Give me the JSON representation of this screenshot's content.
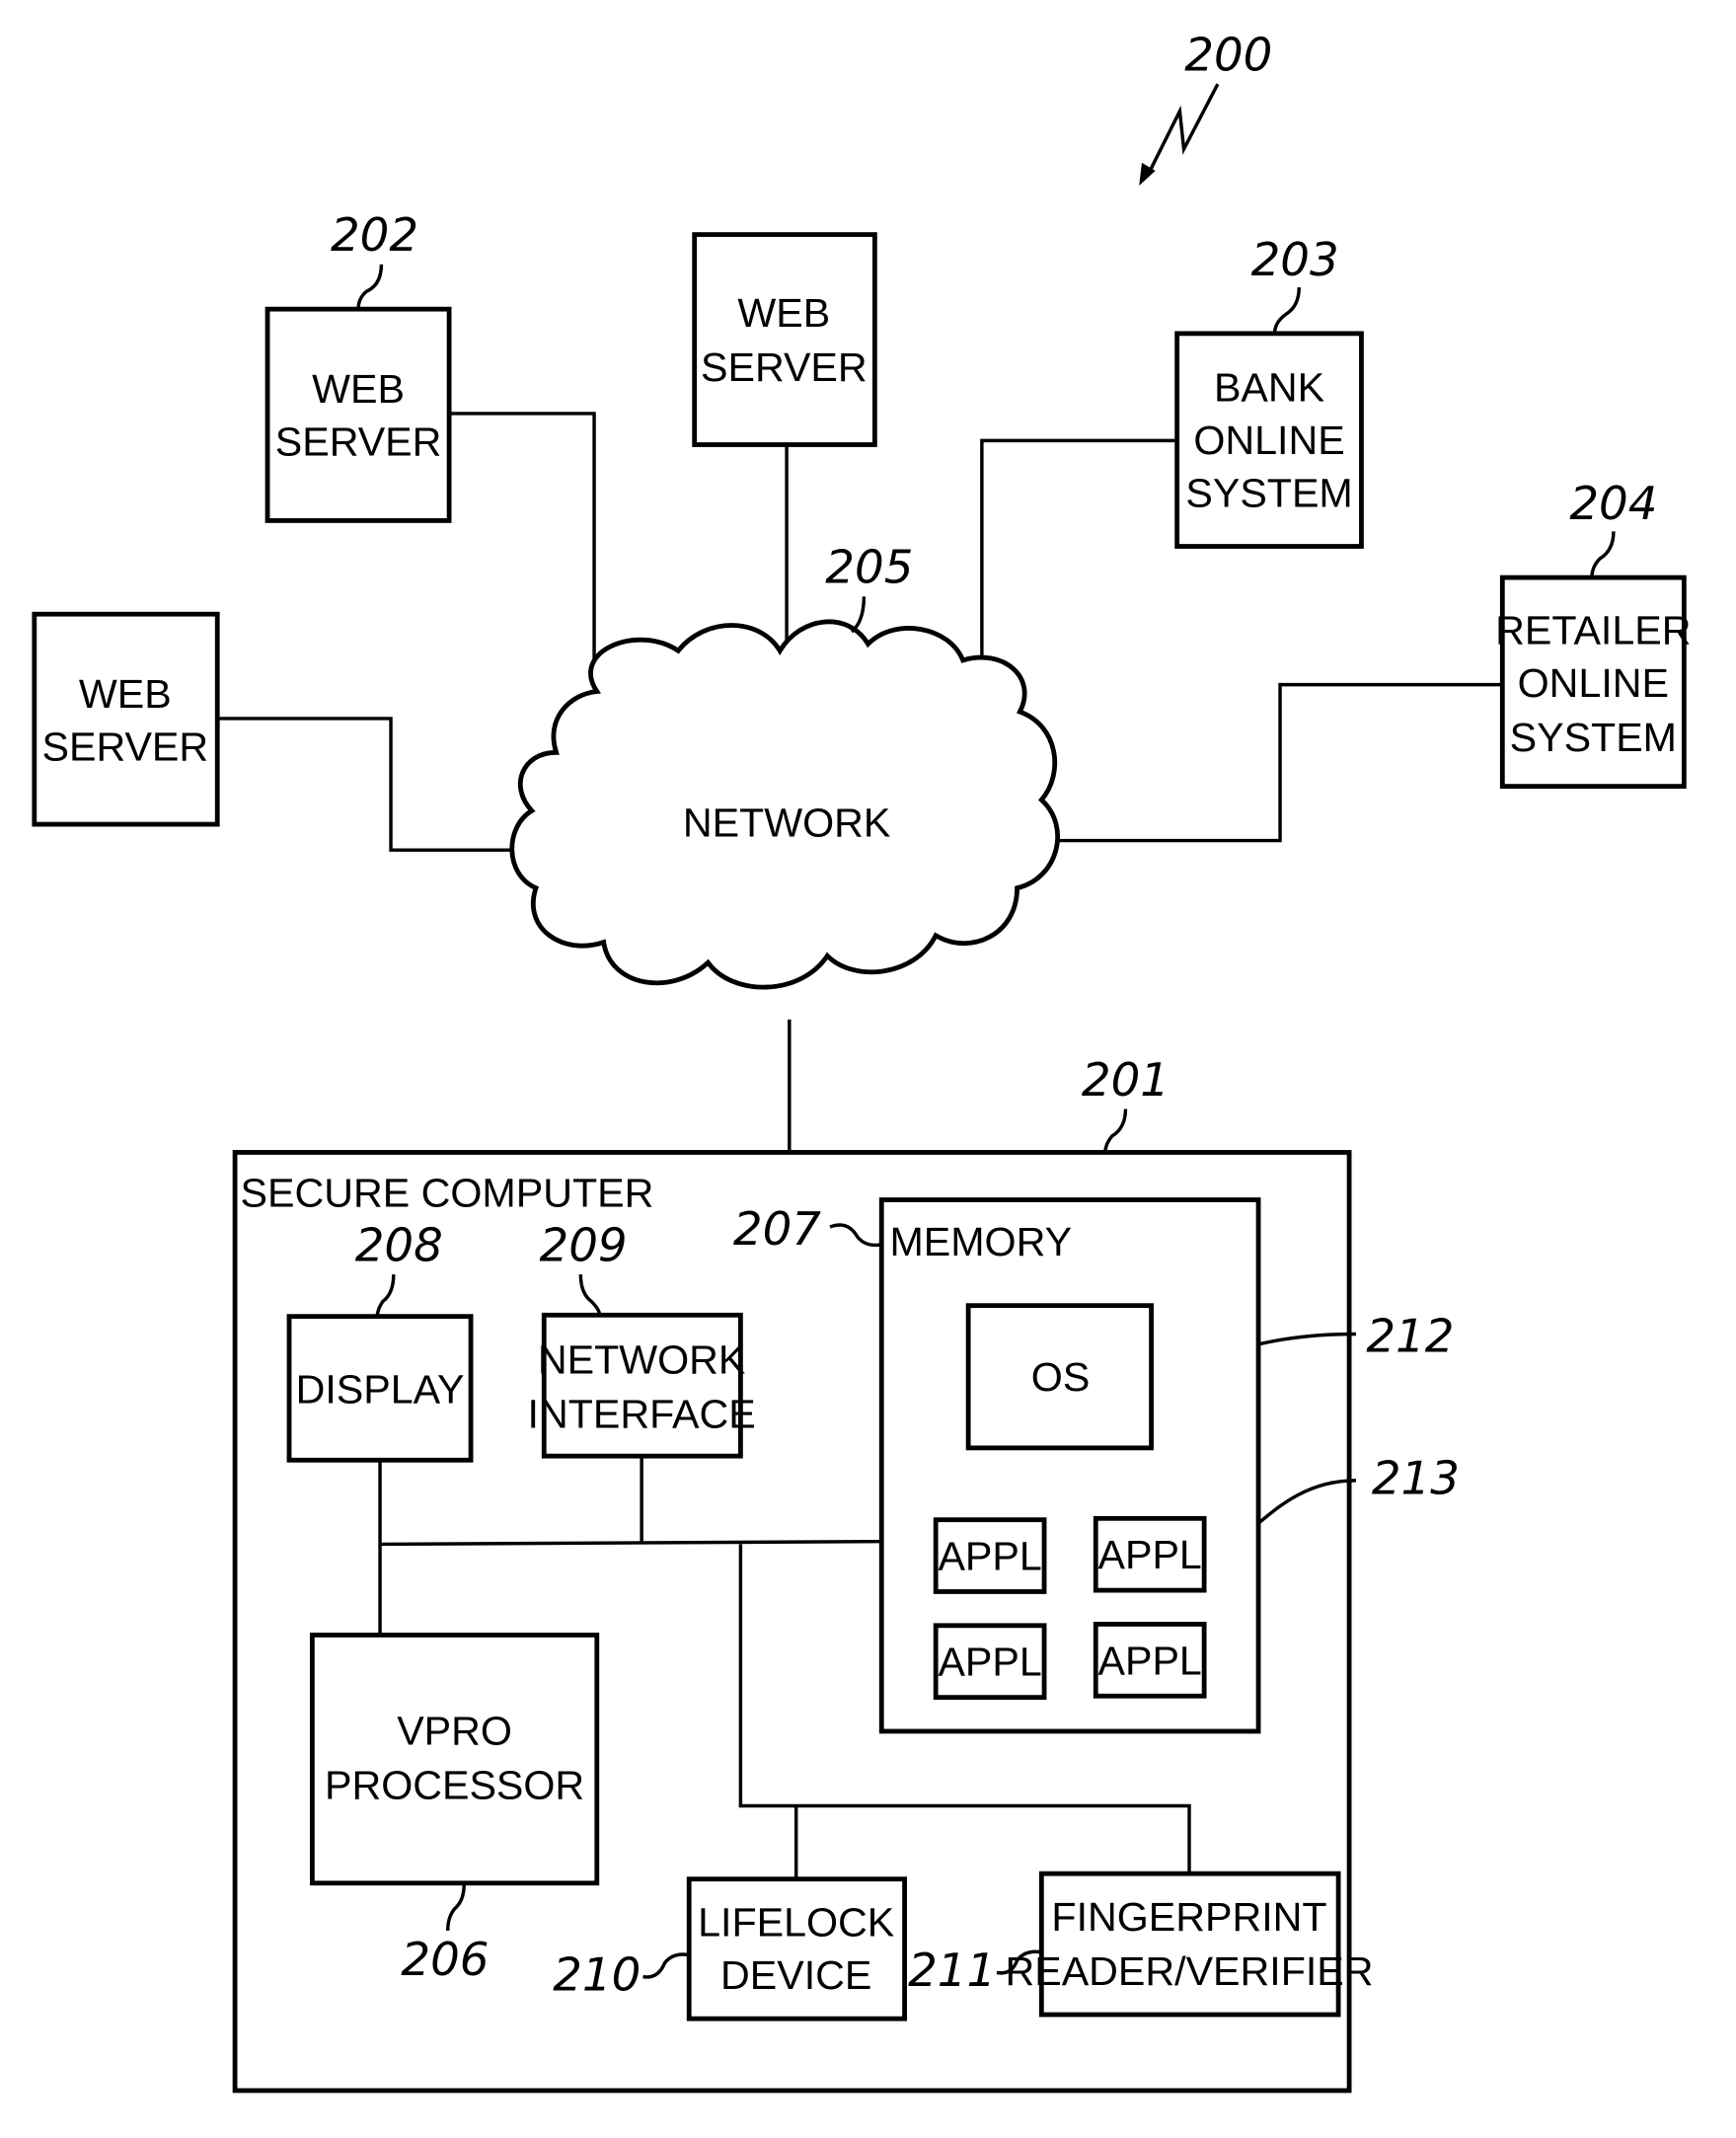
{
  "figure_ref": "200",
  "network": {
    "ref": "205",
    "label": "NETWORK"
  },
  "nodes": {
    "web_server_202": {
      "ref": "202",
      "lines": [
        "WEB",
        "SERVER"
      ]
    },
    "web_server_center": {
      "lines": [
        "WEB",
        "SERVER"
      ]
    },
    "web_server_left": {
      "lines": [
        "WEB",
        "SERVER"
      ]
    },
    "bank_203": {
      "ref": "203",
      "lines": [
        "BANK",
        "ONLINE",
        "SYSTEM"
      ]
    },
    "retailer_204": {
      "ref": "204",
      "lines": [
        "RETAILER",
        "ONLINE",
        "SYSTEM"
      ]
    }
  },
  "secure_computer": {
    "ref": "201",
    "title": "SECURE COMPUTER",
    "display": {
      "ref": "208",
      "label": "DISPLAY"
    },
    "network_interface": {
      "ref": "209",
      "lines": [
        "NETWORK",
        "INTERFACE"
      ]
    },
    "memory": {
      "ref": "207",
      "title": "MEMORY",
      "os": {
        "ref": "212",
        "label": "OS"
      },
      "appl_ref": "213",
      "appls": [
        "APPL",
        "APPL",
        "APPL",
        "APPL"
      ]
    },
    "processor": {
      "ref": "206",
      "lines": [
        "VPRO",
        "PROCESSOR"
      ]
    },
    "lifelock": {
      "ref": "210",
      "lines": [
        "LIFELOCK",
        "DEVICE"
      ]
    },
    "fingerprint": {
      "ref": "211",
      "lines": [
        "FINGERPRINT",
        "READER/VERIFIER"
      ]
    }
  }
}
